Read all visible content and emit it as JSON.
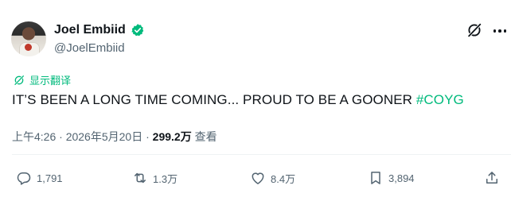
{
  "author": {
    "display_name": "Joel Embiid",
    "handle": "@JoelEmbiid"
  },
  "translate_label": "显示翻译",
  "tweet": {
    "text_main": "IT’S BEEN A LONG TIME COMING... PROUD TO BE A GOONER ",
    "hashtag": "#COYG"
  },
  "meta": {
    "time": "上午4:26",
    "sep1": " · ",
    "date": "2026年5月20日",
    "sep2": " · ",
    "views": "299.2万",
    "views_label": " 查看"
  },
  "actions": {
    "reply_count": "1,791",
    "retweet_count": "1.3万",
    "like_count": "8.4万",
    "bookmark_count": "3,894"
  },
  "colors": {
    "accent": "#00ba7c",
    "secondary_text": "#536471",
    "primary_text": "#0f1419"
  },
  "icons": {
    "verified": "verified-badge-icon",
    "grok": "grok-icon",
    "more": "more-dots-icon",
    "translate": "translate-icon",
    "reply": "reply-icon",
    "retweet": "retweet-icon",
    "like": "heart-icon",
    "bookmark": "bookmark-icon",
    "share": "share-icon"
  }
}
